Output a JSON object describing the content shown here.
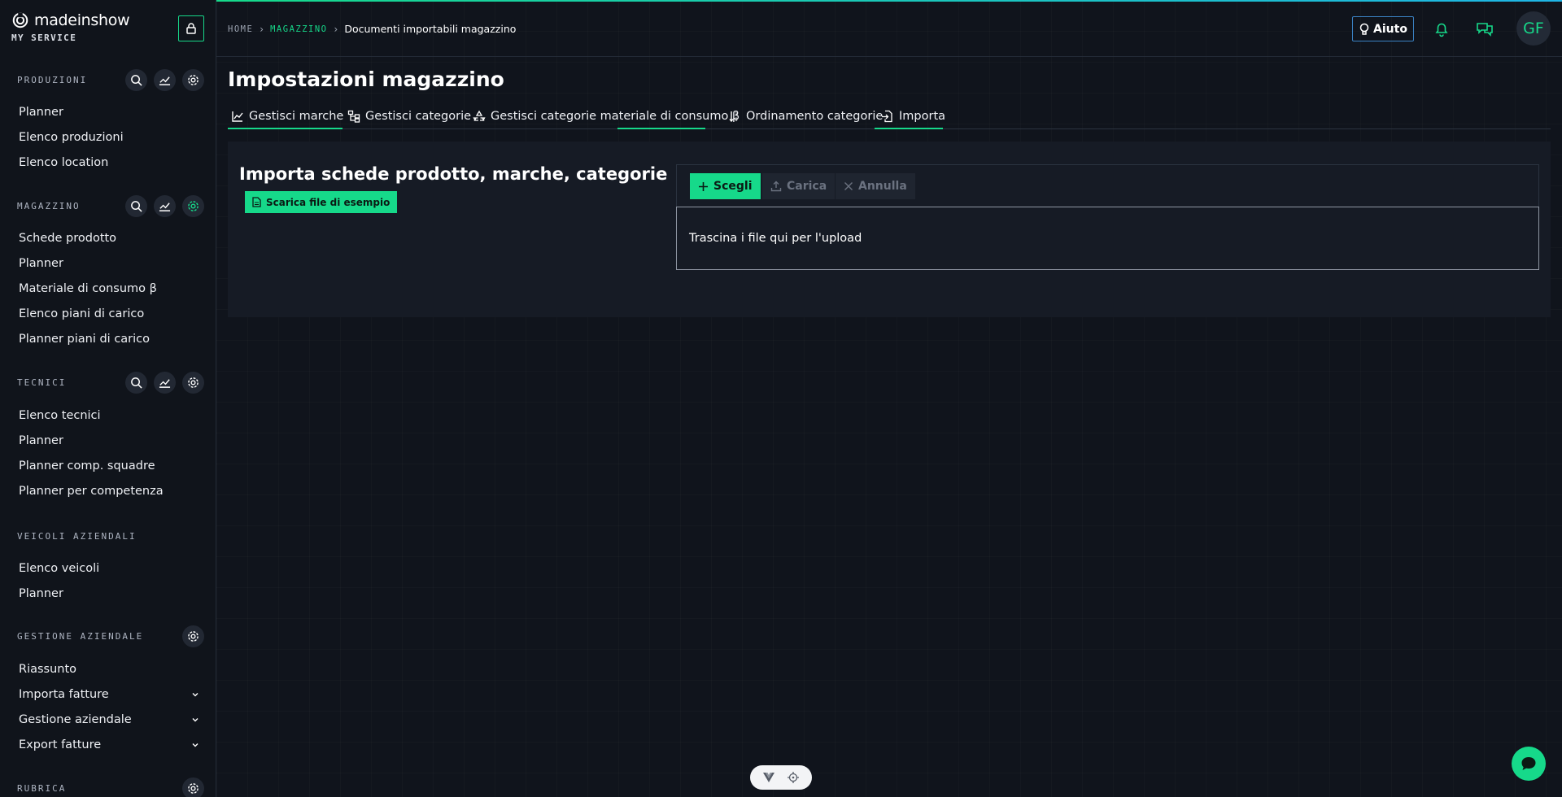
{
  "brand": {
    "name": "madeinshow",
    "subtitle": "MY SERVICE"
  },
  "sidebar": {
    "sections": [
      {
        "title": "PRODUZIONI",
        "items": [
          "Planner",
          "Elenco produzioni",
          "Elenco location"
        ]
      },
      {
        "title": "MAGAZZINO",
        "items": [
          "Schede prodotto",
          "Planner",
          "Materiale di consumo β",
          "Elenco piani di carico",
          "Planner piani di carico"
        ]
      },
      {
        "title": "TECNICI",
        "items": [
          "Elenco tecnici",
          "Planner",
          "Planner comp. squadre",
          "Planner per competenza"
        ]
      },
      {
        "title": "VEICOLI AZIENDALI",
        "items": [
          "Elenco veicoli",
          "Planner"
        ]
      },
      {
        "title": "GESTIONE AZIENDALE",
        "items": [
          "Riassunto",
          "Importa fatture",
          "Gestione aziendale",
          "Export fatture"
        ]
      },
      {
        "title": "RUBRICA",
        "items": []
      }
    ]
  },
  "header": {
    "breadcrumb": {
      "home": "HOME",
      "section": "MAGAZZINO",
      "current": "Documenti importabili magazzino"
    },
    "help_label": "Aiuto",
    "avatar_initials": "GF"
  },
  "main": {
    "title": "Impostazioni magazzino",
    "tabs": [
      {
        "label": "Gestisci marche"
      },
      {
        "label": "Gestisci categorie"
      },
      {
        "label": "Gestisci categorie materiale di consumo β"
      },
      {
        "label": "Ordinamento categorie"
      },
      {
        "label": "Importa"
      }
    ],
    "import": {
      "title": "Importa schede prodotto, marche, categorie",
      "sample_button": "Scarica file di esempio",
      "choose_label": "Scegli",
      "upload_label": "Carica",
      "cancel_label": "Annulla",
      "drop_text": "Trascina i file qui per l'upload"
    }
  },
  "colors": {
    "accent": "#16d98a",
    "help_border": "#3b82c4",
    "background": "#10141c"
  }
}
